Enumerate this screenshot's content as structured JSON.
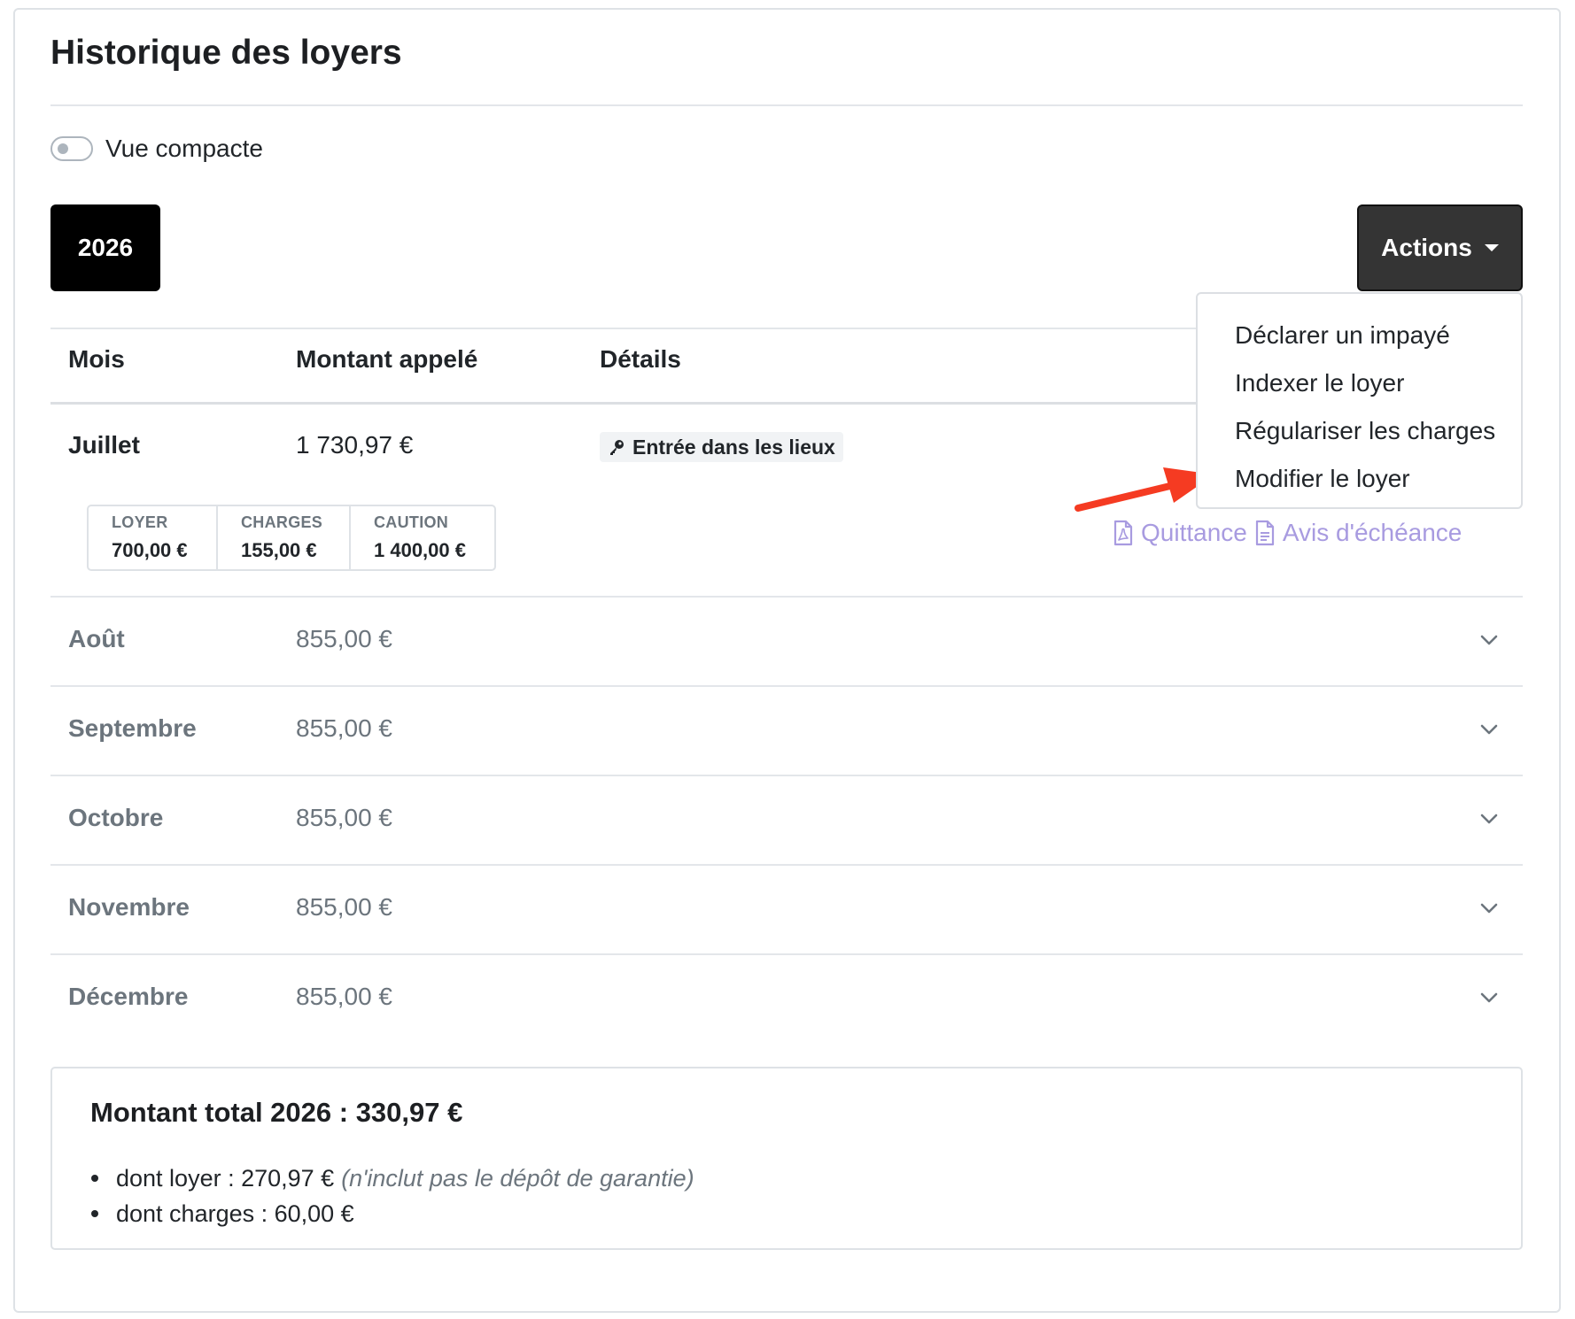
{
  "page": {
    "title": "Historique des loyers"
  },
  "view_toggle": {
    "label": "Vue compacte",
    "checked": false
  },
  "year_selector": {
    "year": "2026"
  },
  "actions": {
    "label": "Actions",
    "menu": [
      {
        "label": "Déclarer un impayé"
      },
      {
        "label": "Indexer le loyer"
      },
      {
        "label": "Régulariser les charges"
      },
      {
        "label": "Modifier le loyer"
      }
    ]
  },
  "table": {
    "headers": {
      "month": "Mois",
      "amount": "Montant appelé",
      "details": "Détails"
    },
    "expanded_row": {
      "month": "Juillet",
      "amount": "1 730,97 €",
      "detail_badge": "Entrée dans les lieux",
      "breakdown": [
        {
          "label": "LOYER",
          "value": "700,00 €"
        },
        {
          "label": "CHARGES",
          "value": "155,00 €"
        },
        {
          "label": "CAUTION",
          "value": "1 400,00 €"
        }
      ],
      "documents": [
        {
          "label": "Quittance",
          "icon": "file-pdf-icon"
        },
        {
          "label": "Avis d'échéance",
          "icon": "file-text-icon"
        }
      ]
    },
    "rows": [
      {
        "month": "Août",
        "amount": "855,00 €"
      },
      {
        "month": "Septembre",
        "amount": "855,00 €"
      },
      {
        "month": "Octobre",
        "amount": "855,00 €"
      },
      {
        "month": "Novembre",
        "amount": "855,00 €"
      },
      {
        "month": "Décembre",
        "amount": "855,00 €"
      }
    ]
  },
  "total": {
    "title": "Montant total 2026 : 330,97 €",
    "items": [
      {
        "text": "dont loyer : 270,97 €",
        "note": "(n'inclut pas le dépôt de garantie)"
      },
      {
        "text": "dont charges : 60,00 €",
        "note": ""
      }
    ]
  },
  "colors": {
    "link": "#a89be0",
    "annotation_arrow": "#f53b22",
    "year_button": "#000000",
    "actions_button": "#343434",
    "muted_text": "#6c757d"
  }
}
